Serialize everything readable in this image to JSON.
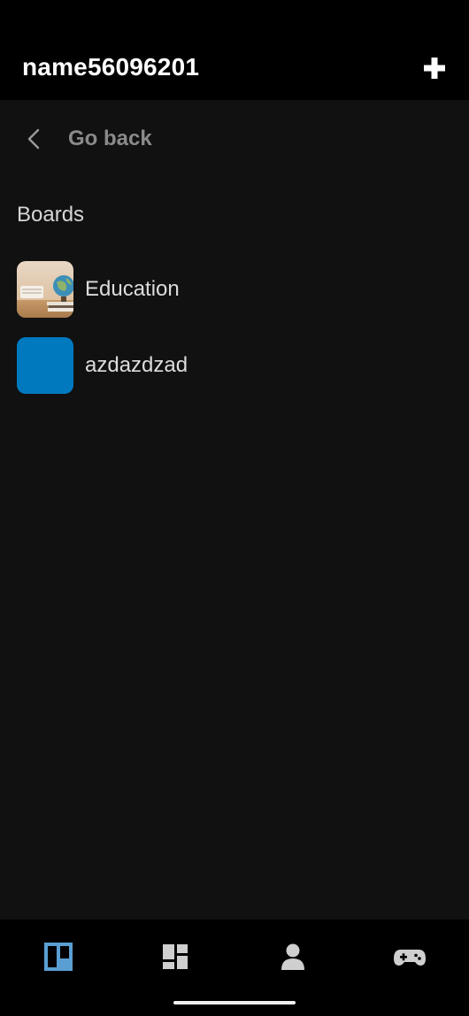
{
  "header": {
    "title": "name56096201",
    "add_icon": "plus-icon"
  },
  "navigation": {
    "back_label": "Go back",
    "back_icon": "chevron-left-icon"
  },
  "boards_section": {
    "title": "Boards",
    "items": [
      {
        "label": "Education",
        "thumbnail": "photo"
      },
      {
        "label": "azdazdzad",
        "thumbnail": "color",
        "color": "#0079bf"
      }
    ]
  },
  "bottom_nav": {
    "items": [
      {
        "icon": "boards-icon",
        "active": true
      },
      {
        "icon": "dashboard-icon",
        "active": false
      },
      {
        "icon": "profile-icon",
        "active": false
      },
      {
        "icon": "gamepad-icon",
        "active": false
      }
    ],
    "active_color": "#5a9fd4",
    "inactive_color": "#cfcfcf"
  },
  "colors": {
    "background": "#111111",
    "top_bar": "#000000",
    "board_blue": "#0079bf"
  }
}
